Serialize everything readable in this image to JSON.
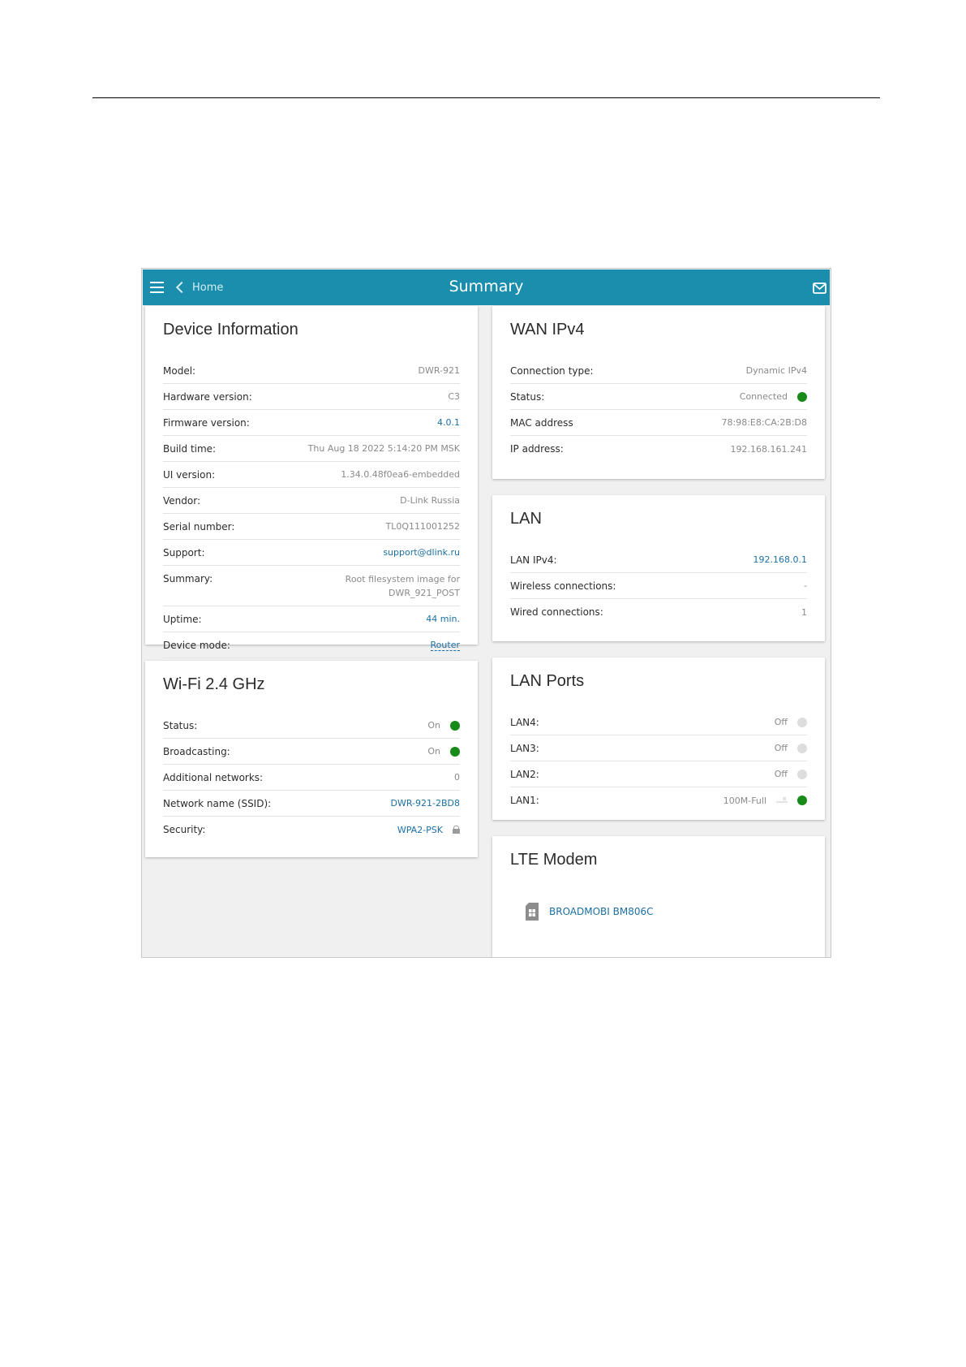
{
  "header": {
    "home_label": "Home",
    "title": "Summary"
  },
  "device_info": {
    "title": "Device Information",
    "rows": [
      {
        "label": "Model:",
        "value": "DWR-921"
      },
      {
        "label": "Hardware version:",
        "value": "C3"
      },
      {
        "label": "Firmware version:",
        "value": "4.0.1"
      },
      {
        "label": "Build time:",
        "value": "Thu Aug 18 2022 5:14:20 PM MSK"
      },
      {
        "label": "UI version:",
        "value": "1.34.0.48f0ea6-embedded"
      },
      {
        "label": "Vendor:",
        "value": "D-Link Russia"
      },
      {
        "label": "Serial number:",
        "value": "TL0Q111001252"
      },
      {
        "label": "Support:",
        "value": "support@dlink.ru"
      },
      {
        "label": "Summary:",
        "value": "Root filesystem image for DWR_921_POST"
      },
      {
        "label": "Uptime:",
        "value": "44 min."
      },
      {
        "label": "Device mode:",
        "value": "Router"
      }
    ]
  },
  "wifi": {
    "title": "Wi-Fi 2.4 GHz",
    "rows": [
      {
        "label": "Status:",
        "value": "On",
        "indicator": "green"
      },
      {
        "label": "Broadcasting:",
        "value": "On",
        "indicator": "green"
      },
      {
        "label": "Additional networks:",
        "value": "0"
      },
      {
        "label": "Network name (SSID):",
        "value": "DWR-921-2BD8"
      },
      {
        "label": "Security:",
        "value": "WPA2-PSK",
        "icon": "lock-icon"
      }
    ]
  },
  "wan": {
    "title": "WAN IPv4",
    "rows": [
      {
        "label": "Connection type:",
        "value": "Dynamic IPv4"
      },
      {
        "label": "Status:",
        "value": "Connected",
        "indicator": "green"
      },
      {
        "label": "MAC address",
        "value": "78:98:E8:CA:2B:D8"
      },
      {
        "label": "IP address:",
        "value": "192.168.161.241"
      }
    ]
  },
  "lan": {
    "title": "LAN",
    "rows": [
      {
        "label": "LAN IPv4:",
        "value": "192.168.0.1"
      },
      {
        "label": "Wireless connections:",
        "value": "-"
      },
      {
        "label": "Wired connections:",
        "value": "1"
      }
    ]
  },
  "lan_ports": {
    "title": "LAN Ports",
    "rows": [
      {
        "label": "LAN4:",
        "value": "Off",
        "indicator": "gray"
      },
      {
        "label": "LAN3:",
        "value": "Off",
        "indicator": "gray"
      },
      {
        "label": "LAN2:",
        "value": "Off",
        "indicator": "gray"
      },
      {
        "label": "LAN1:",
        "value": "100M-Full",
        "indicator": "green",
        "icon": "ethernet-port-icon"
      }
    ]
  },
  "lte": {
    "title": "LTE Modem",
    "modem_name": "BROADMOBI BM806C"
  },
  "colors": {
    "header_bg": "#1b8ead",
    "link": "#1c6fa3",
    "status_green": "#178a17",
    "status_gray": "#dddddd"
  }
}
